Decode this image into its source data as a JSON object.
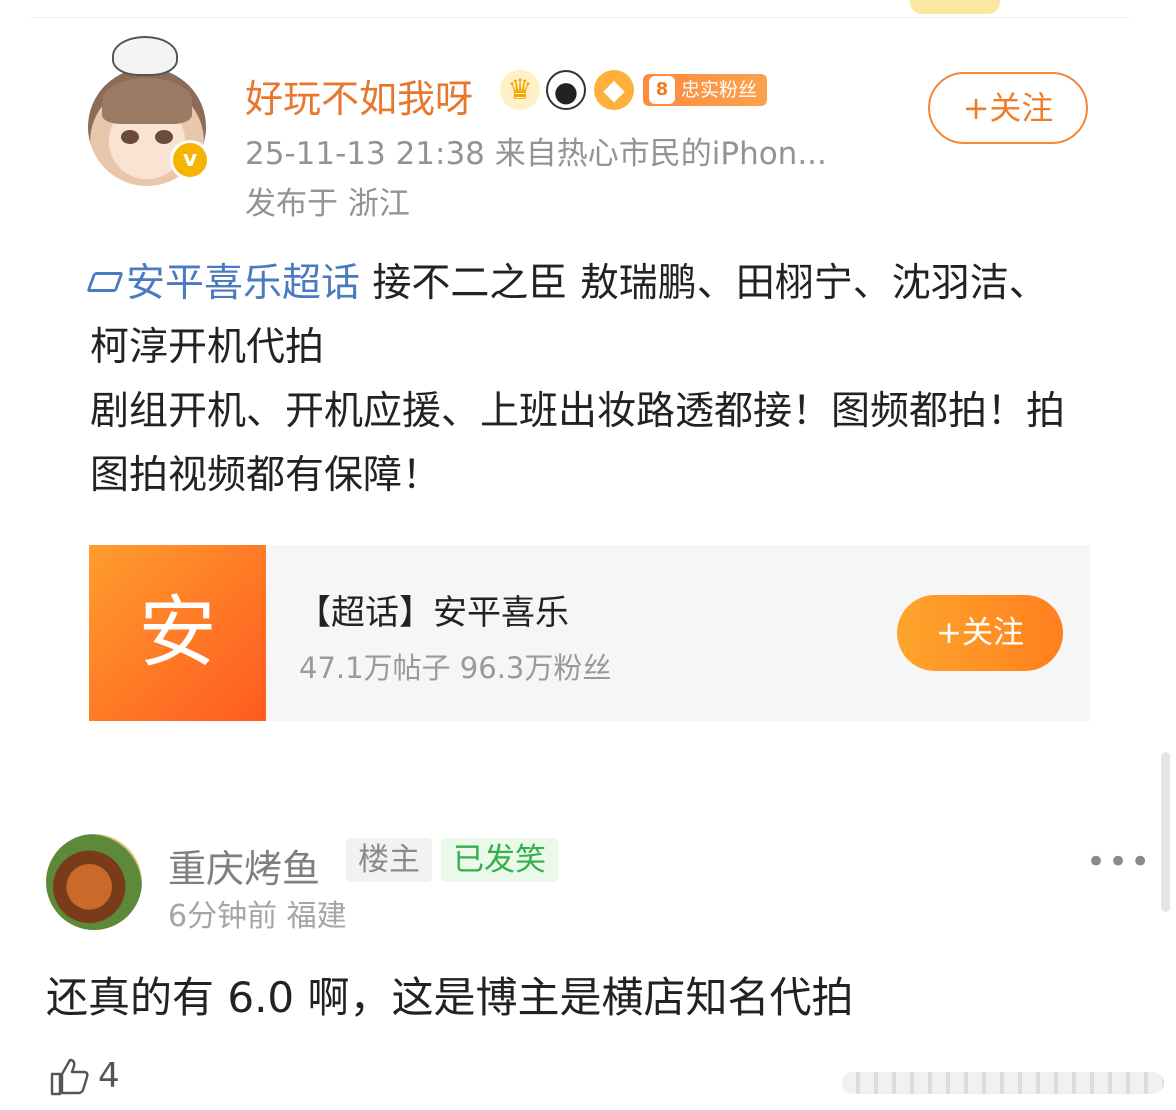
{
  "post": {
    "username": "好玩不如我呀",
    "badges": [
      "crown-icon",
      "panda-icon",
      "fish-icon"
    ],
    "fan_badge": {
      "level": "8",
      "label": "忠实粉丝"
    },
    "time": "25-11-13 21:38",
    "source_prefix": "来自",
    "source": "热心市民的iPhon...",
    "location": "发布于 浙江",
    "follow_label": "+关注",
    "topic_tag": "安平喜乐超话",
    "content_line1": " 接不二之臣 敖瑞鹏、田栩宁、沈羽洁、柯淳开机代拍",
    "content_line2": "剧组开机、开机应援、上班出妆路透都接！图频都拍！拍图拍视频都有保障！",
    "topic_card": {
      "thumb_char": "安",
      "title": "【超话】安平喜乐",
      "stats": "47.1万帖子 96.3万粉丝",
      "follow_label": "+关注"
    }
  },
  "comment": {
    "name": "重庆烤鱼",
    "tag_owner": "楼主",
    "tag_smile": "已发笑",
    "meta": "6分钟前 福建",
    "text": "还真的有 6.0 啊，这是博主是横店知名代拍",
    "likes": "4",
    "more_label": "•••"
  },
  "colors": {
    "accent_orange": "#f07c2a",
    "topic_blue": "#4a7bc1",
    "smile_green": "#33b04a"
  }
}
